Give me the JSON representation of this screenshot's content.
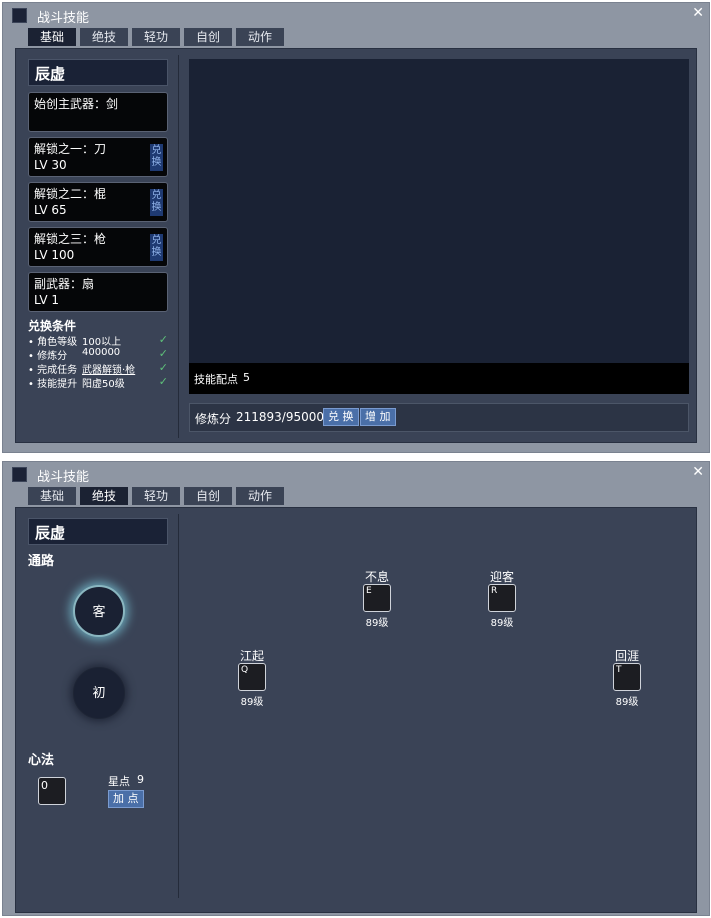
{
  "window1": {
    "title": "战斗技能",
    "close_glyph": "✕",
    "tabs": [
      {
        "label": "基础",
        "active": true
      },
      {
        "label": "绝技",
        "active": false
      },
      {
        "label": "轻功",
        "active": false
      },
      {
        "label": "自创",
        "active": false
      },
      {
        "label": "动作",
        "active": false
      }
    ],
    "character_name": "辰虚",
    "weapons": [
      {
        "line1": "始创主武器：剑",
        "line2": ""
      },
      {
        "line1": "解锁之一：刀",
        "line2": "LV 30",
        "exchange": "兑换"
      },
      {
        "line1": "解锁之二：棍",
        "line2": "LV 65",
        "exchange": "兑换"
      },
      {
        "line1": "解锁之三：枪",
        "line2": "LV 100",
        "exchange": "兑换"
      },
      {
        "line1": "副武器：扇",
        "line2": "LV 1"
      }
    ],
    "conditions_title": "兑换条件",
    "conditions": [
      {
        "label": "• 角色等级",
        "value": "100以上",
        "check": "✓"
      },
      {
        "label": "• 修炼分",
        "value": "400000",
        "check": "✓"
      },
      {
        "label": "• 完成任务",
        "value": "武器解锁·枪",
        "check": "✓"
      },
      {
        "label": "• 技能提升",
        "value": "阳虚50级",
        "check": "✓"
      }
    ],
    "skill_points_label": "技能配点",
    "skill_points_value": "5",
    "cultivation_label": "修炼分",
    "cultivation_value": "211893/950000",
    "exchange_button": "兑 换",
    "add_button": "增 加"
  },
  "window2": {
    "title": "战斗技能",
    "close_glyph": "✕",
    "tabs": [
      {
        "label": "基础",
        "active": false
      },
      {
        "label": "绝技",
        "active": true
      },
      {
        "label": "轻功",
        "active": false
      },
      {
        "label": "自创",
        "active": false
      },
      {
        "label": "动作",
        "active": false
      }
    ],
    "character_name": "辰虚",
    "path_label": "通路",
    "paths": [
      {
        "label": "客",
        "active": true
      },
      {
        "label": "初",
        "active": false
      }
    ],
    "skills": [
      {
        "name": "不息",
        "key": "E",
        "level": "89级"
      },
      {
        "name": "迎客",
        "key": "R",
        "level": "89级"
      },
      {
        "name": "江起",
        "key": "Q",
        "level": "89级"
      },
      {
        "name": "回涯",
        "key": "T",
        "level": "89级"
      }
    ],
    "heart_label": "心法",
    "heart_slot_key": "0",
    "star_label": "星点",
    "star_value": "9",
    "add_point_button": "加 点"
  }
}
